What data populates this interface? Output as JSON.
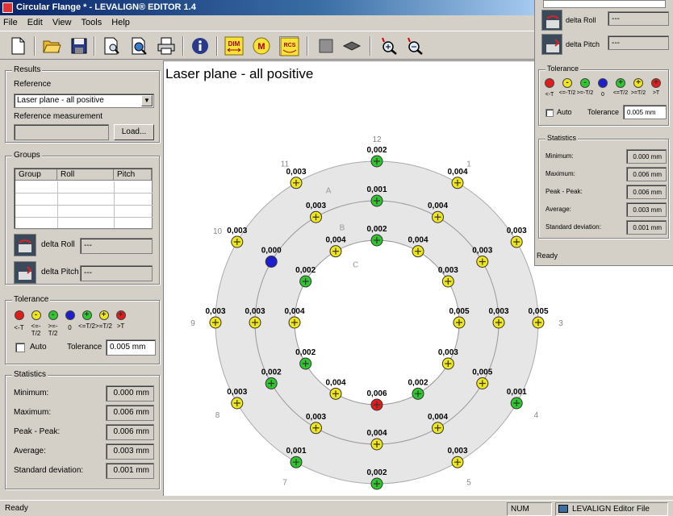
{
  "window": {
    "title": "Circular Flange * - LEVALIGN® EDITOR 1.4"
  },
  "menu": [
    "File",
    "Edit",
    "View",
    "Tools",
    "Help"
  ],
  "toolbar": {
    "buttons": [
      "new-icon",
      "open-icon",
      "save-icon",
      "print-preview-icon",
      "preview-zoom-icon",
      "printer-icon",
      "info-icon",
      "dim-icon",
      "m-icon",
      "rcs-icon",
      "square-icon",
      "layer-icon",
      "zoom-in-icon",
      "zoom-out-icon"
    ],
    "labels": {
      "dim": "DIM",
      "m": "M",
      "rcs": "RCS"
    }
  },
  "results": {
    "title": "Results",
    "reference_label": "Reference",
    "reference_value": "Laser plane - all positive",
    "refmeas_label": "Reference measurement",
    "load_button": "Load..."
  },
  "groups": {
    "title": "Groups",
    "columns": [
      "Group",
      "Roll",
      "Pitch"
    ],
    "delta_roll_label": "delta Roll",
    "delta_roll_value": "---",
    "delta_pitch_label": "delta Pitch",
    "delta_pitch_value": "---"
  },
  "tolerance": {
    "title": "Tolerance",
    "legend": [
      {
        "label": "<-T",
        "color": "#e21b1b",
        "symbol": ""
      },
      {
        "label": "<=-T/2",
        "color": "#f0e61e",
        "symbol": "-"
      },
      {
        "label": ">=-T/2",
        "color": "#2ec82e",
        "symbol": "-"
      },
      {
        "label": "0",
        "color": "#1e1ecc",
        "symbol": ""
      },
      {
        "label": "<=T/2",
        "color": "#2ec82e",
        "symbol": "+"
      },
      {
        "label": ">=T/2",
        "color": "#f0e61e",
        "symbol": "+"
      },
      {
        "label": ">T",
        "color": "#e21b1b",
        "symbol": "+"
      }
    ],
    "auto_label": "Auto",
    "tolerance_label": "Tolerance",
    "tolerance_value": "0.005 mm"
  },
  "statistics": {
    "title": "Statistics",
    "rows": [
      {
        "label": "Minimum:",
        "value": "0.000 mm"
      },
      {
        "label": "Maximum:",
        "value": "0.006 mm"
      },
      {
        "label": "Peak - Peak:",
        "value": "0.006 mm"
      },
      {
        "label": "Average:",
        "value": "0.003 mm"
      },
      {
        "label": "Standard deviation:",
        "value": "0.001 mm"
      }
    ]
  },
  "plot": {
    "title": "Laser plane - all positive",
    "ring_labels": [
      "A",
      "B",
      "C"
    ],
    "clock_numbers": [
      "1",
      "2",
      "3",
      "4",
      "5",
      "6",
      "7",
      "8",
      "9",
      "10",
      "11",
      "12"
    ],
    "outer": [
      {
        "angle": 0,
        "value": "0,002",
        "color": "#2ec82e"
      },
      {
        "angle": 30,
        "value": "0,004",
        "color": "#f0e61e"
      },
      {
        "angle": 60,
        "value": "0,003",
        "color": "#f0e61e"
      },
      {
        "angle": 90,
        "value": "0,005",
        "color": "#f0e61e"
      },
      {
        "angle": 120,
        "value": "0,001",
        "color": "#2ec82e"
      },
      {
        "angle": 150,
        "value": "0,003",
        "color": "#f0e61e"
      },
      {
        "angle": 180,
        "value": "0,002",
        "color": "#2ec82e"
      },
      {
        "angle": 210,
        "value": "0,001",
        "color": "#2ec82e"
      },
      {
        "angle": 240,
        "value": "0,003",
        "color": "#f0e61e"
      },
      {
        "angle": 270,
        "value": "0,003",
        "color": "#f0e61e"
      },
      {
        "angle": 300,
        "value": "0,003",
        "color": "#f0e61e"
      },
      {
        "angle": 330,
        "value": "0,003",
        "color": "#f0e61e"
      }
    ],
    "middle": [
      {
        "angle": 0,
        "value": "0,001",
        "color": "#2ec82e"
      },
      {
        "angle": 30,
        "value": "0,004",
        "color": "#f0e61e"
      },
      {
        "angle": 60,
        "value": "0,003",
        "color": "#f0e61e"
      },
      {
        "angle": 90,
        "value": "0,003",
        "color": "#f0e61e"
      },
      {
        "angle": 120,
        "value": "0,005",
        "color": "#f0e61e"
      },
      {
        "angle": 150,
        "value": "0,004",
        "color": "#f0e61e"
      },
      {
        "angle": 180,
        "value": "0,004",
        "color": "#f0e61e"
      },
      {
        "angle": 210,
        "value": "0,003",
        "color": "#f0e61e"
      },
      {
        "angle": 240,
        "value": "0,002",
        "color": "#2ec82e"
      },
      {
        "angle": 270,
        "value": "0,003",
        "color": "#f0e61e"
      },
      {
        "angle": 300,
        "value": "0,000",
        "color": "#1e1ecc"
      },
      {
        "angle": 330,
        "value": "0,003",
        "color": "#f0e61e"
      }
    ],
    "inner": [
      {
        "angle": 0,
        "value": "0,002",
        "color": "#2ec82e"
      },
      {
        "angle": 30,
        "value": "0,004",
        "color": "#f0e61e"
      },
      {
        "angle": 60,
        "value": "0,003",
        "color": "#f0e61e"
      },
      {
        "angle": 90,
        "value": "0,005",
        "color": "#f0e61e"
      },
      {
        "angle": 120,
        "value": "0,003",
        "color": "#f0e61e"
      },
      {
        "angle": 150,
        "value": "0,002",
        "color": "#2ec82e"
      },
      {
        "angle": 180,
        "value": "0,006",
        "color": "#e21b1b"
      },
      {
        "angle": 210,
        "value": "0,004",
        "color": "#f0e61e"
      },
      {
        "angle": 240,
        "value": "0,002",
        "color": "#2ec82e"
      },
      {
        "angle": 270,
        "value": "0,004",
        "color": "#f0e61e"
      },
      {
        "angle": 300,
        "value": "0,002",
        "color": "#2ec82e"
      },
      {
        "angle": 330,
        "value": "0,004",
        "color": "#f0e61e"
      }
    ]
  },
  "statusbar": {
    "left": "Ready",
    "num": "NUM",
    "file": "LEVALIGN Editor File"
  },
  "overlay": {
    "delta_roll_label": "delta Roll",
    "delta_roll_value": "---",
    "delta_pitch_label": "delta Pitch",
    "delta_pitch_value": "---",
    "tolerance_title": "Tolerance",
    "auto_label": "Auto",
    "tolerance_label": "Tolerance",
    "tolerance_value": "0.005 mm",
    "statistics_title": "Statistics",
    "status": "Ready"
  }
}
